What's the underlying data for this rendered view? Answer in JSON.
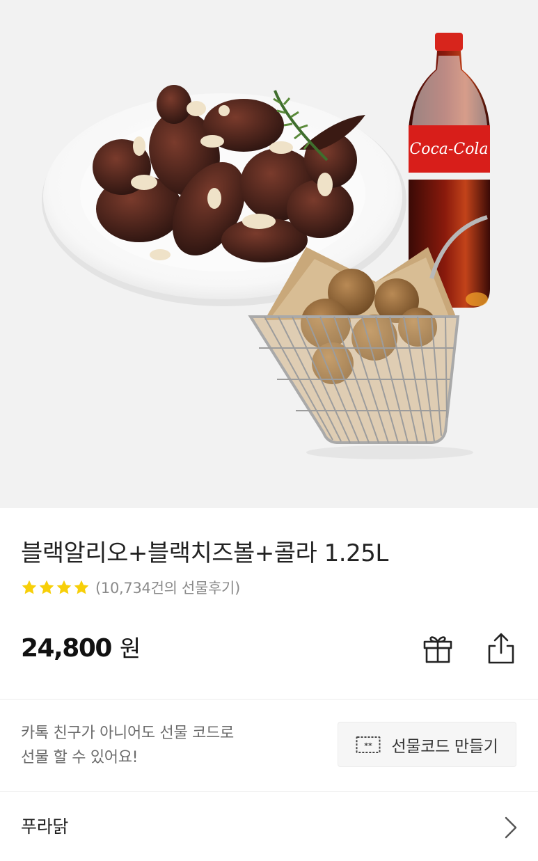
{
  "hero": {
    "image_alt": "",
    "bottle_label": "Coca-Cola"
  },
  "product": {
    "title": "블랙알리오+블랙치즈볼+콜라 1.25L",
    "rating_stars": 4,
    "review_count_text": "(10,734건의 선물후기)",
    "star_color": "#f7cf08"
  },
  "price": {
    "value": "24,800",
    "unit": "원"
  },
  "actions": {
    "gift_icon": "gift-icon",
    "share_icon": "share-icon"
  },
  "gift_code": {
    "desc_line1": "카톡 친구가 아니어도 선물 코드로",
    "desc_line2": "선물 할 수 있어요!",
    "button_label": "선물코드 만들기",
    "button_icon": "ticket-icon"
  },
  "brand": {
    "name": "푸라닭",
    "chevron_icon": "chevron-right-icon"
  }
}
